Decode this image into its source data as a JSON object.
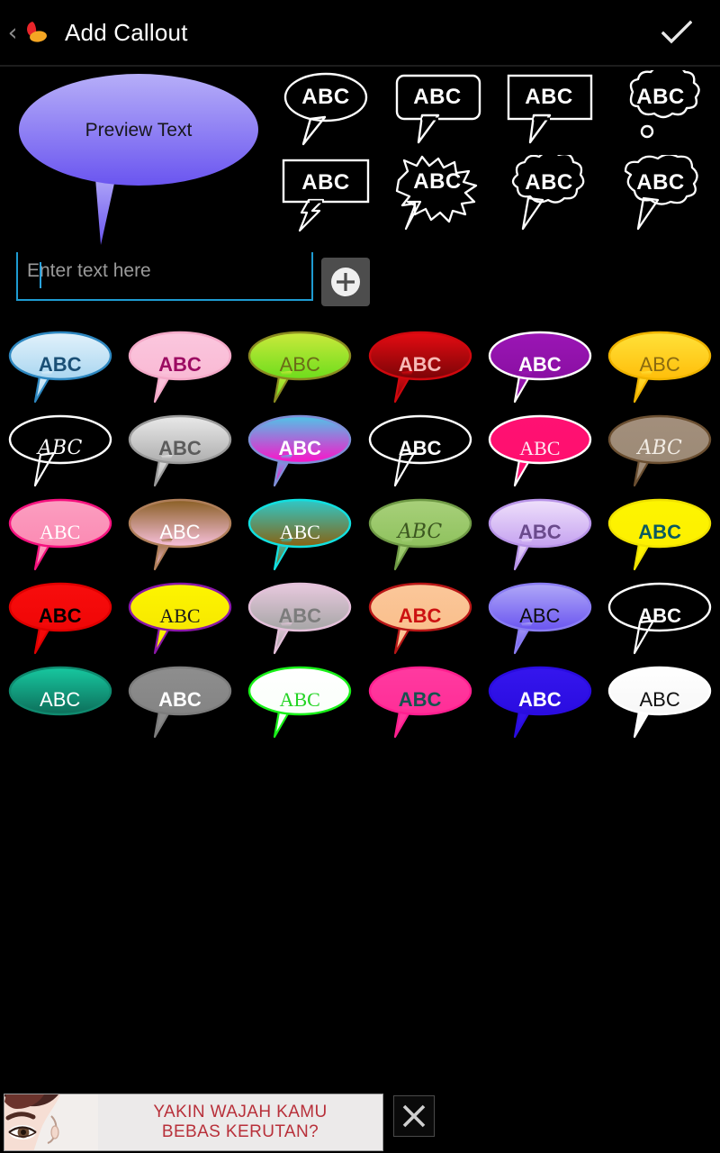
{
  "header": {
    "back_label": "‹",
    "title": "Add Callout",
    "confirm_icon": "check-icon",
    "app_icon": "app-logo-icon"
  },
  "preview": {
    "text": "Preview Text",
    "fill_top": "#b0a8f7",
    "fill_bottom": "#6a55f0",
    "text_color": "#17171b"
  },
  "shapes": {
    "sample_label": "ABC",
    "items": [
      {
        "name": "ellipse",
        "label": "ABC"
      },
      {
        "name": "rounded-rect",
        "label": "ABC"
      },
      {
        "name": "rect",
        "label": "ABC"
      },
      {
        "name": "thought-cloud",
        "label": "ABC"
      },
      {
        "name": "rect-zigzag-tail",
        "label": "ABC"
      },
      {
        "name": "starburst",
        "label": "ABC"
      },
      {
        "name": "cloud",
        "label": "ABC"
      },
      {
        "name": "rounded-cloud",
        "label": "ABC"
      }
    ]
  },
  "input": {
    "placeholder": "Enter text here",
    "value": "",
    "underline_color": "#1e9bd1",
    "add_button_icon": "plus-icon"
  },
  "styles": {
    "label": "ABC",
    "items": [
      {
        "name": "light-blue",
        "label": "ABC",
        "fill_top": "#e2f2fb",
        "fill_bottom": "#aad6f0",
        "stroke": "#2d87c0",
        "text_color": "#1a4f75",
        "font": "f-bold",
        "tail": true
      },
      {
        "name": "pink-magenta",
        "label": "ABC",
        "fill_top": "#fbc7de",
        "fill_bottom": "#f9b9d4",
        "stroke": "#f4a9c8",
        "text_color": "#9c0b62",
        "font": "f-bold",
        "tail": true
      },
      {
        "name": "yellow-green",
        "label": "ABC",
        "fill_top": "#cbe93c",
        "fill_bottom": "#6ddd1c",
        "stroke": "#8a8a20",
        "text_color": "#6b6b18",
        "font": "",
        "tail": true
      },
      {
        "name": "dark-red",
        "label": "ABC",
        "fill_top": "#e60b12",
        "fill_bottom": "#7a0407",
        "stroke": "#d0080e",
        "text_color": "#f7b9b6",
        "font": "f-bold",
        "tail": true
      },
      {
        "name": "purple-white-border",
        "label": "ABC",
        "fill_top": "#9b16b5",
        "fill_bottom": "#8a0fa3",
        "stroke": "#ffffff",
        "text_color": "#ffffff",
        "font": "f-bold",
        "tail": true
      },
      {
        "name": "yellow-brown-text",
        "label": "ABC",
        "fill_top": "#ffe23a",
        "fill_bottom": "#ffbe0a",
        "stroke": "#f0b400",
        "text_color": "#8a6a10",
        "font": "",
        "tail": true
      },
      {
        "name": "outline-white-hand",
        "label": "ABC",
        "fill_top": "transparent",
        "fill_bottom": "transparent",
        "stroke": "#ffffff",
        "text_color": "#ffffff",
        "font": "f-hand",
        "tail": true
      },
      {
        "name": "silver-grey",
        "label": "ABC",
        "fill_top": "#e9e9e9",
        "fill_bottom": "#aeaeae",
        "stroke": "#9a9a9a",
        "text_color": "#5c5c5c",
        "font": "f-bold",
        "tail": true
      },
      {
        "name": "cyan-magenta-gradient",
        "label": "ABC",
        "fill_top": "#4fc5e8",
        "fill_bottom": "#ff10c8",
        "stroke": "#7f8fd8",
        "text_color": "#ffffff",
        "font": "f-bold",
        "tail": true
      },
      {
        "name": "outline-white-bold",
        "label": "ABC",
        "fill_top": "transparent",
        "fill_bottom": "transparent",
        "stroke": "#ffffff",
        "text_color": "#ffffff",
        "font": "f-bold",
        "tail": true
      },
      {
        "name": "hot-pink-serif",
        "label": "ABC",
        "fill_top": "#ff1173",
        "fill_bottom": "#ff0f6e",
        "stroke": "#ffffff",
        "text_color": "#ffe8f2",
        "font": "f-serif",
        "tail": true
      },
      {
        "name": "brown-tan",
        "label": "ABC",
        "fill_top": "#a38f7c",
        "fill_bottom": "#9c8a76",
        "stroke": "#6b4f31",
        "text_color": "#f2ece4",
        "font": "f-hand",
        "tail": true
      },
      {
        "name": "pink-serif",
        "label": "ABC",
        "fill_top": "#fb9ec0",
        "fill_bottom": "#fb8ab3",
        "stroke": "#f5117e",
        "text_color": "#ffffff",
        "font": "f-serif",
        "tail": true
      },
      {
        "name": "brown-pink-gradient",
        "label": "ABC",
        "fill_top": "#8a5f24",
        "fill_bottom": "#f8c1dd",
        "stroke": "#b07f5a",
        "text_color": "#ffffff",
        "font": "",
        "tail": true
      },
      {
        "name": "teal-brown-gradient",
        "label": "ABC",
        "fill_top": "#2fc8c8",
        "fill_bottom": "#8a6210",
        "stroke": "#12e0e0",
        "text_color": "#ffffff",
        "font": "f-serif",
        "tail": true
      },
      {
        "name": "light-green-hand",
        "label": "ABC",
        "fill_top": "#a8d07a",
        "fill_bottom": "#8fc25e",
        "stroke": "#6f9a45",
        "text_color": "#3c5720",
        "font": "f-hand",
        "tail": true
      },
      {
        "name": "lavender",
        "label": "ABC",
        "fill_top": "#efe0fb",
        "fill_bottom": "#c5a2f0",
        "stroke": "#b894e8",
        "text_color": "#6a4a8c",
        "font": "f-bold",
        "tail": true
      },
      {
        "name": "bright-yellow-teal-text",
        "label": "ABC",
        "fill_top": "#fdf500",
        "fill_bottom": "#fdf000",
        "stroke": "#f0e200",
        "text_color": "#0a5a60",
        "font": "f-bold",
        "tail": true
      },
      {
        "name": "bright-red-black-text",
        "label": "ABC",
        "fill_top": "#f80d0d",
        "fill_bottom": "#ef0606",
        "stroke": "#e00000",
        "text_color": "#000000",
        "font": "f-bold",
        "tail": true
      },
      {
        "name": "yellow-purple-border",
        "label": "ABC",
        "fill_top": "#fdf500",
        "fill_bottom": "#f7e800",
        "stroke": "#8a17a8",
        "text_color": "#1a1a1a",
        "font": "f-serif",
        "tail": true
      },
      {
        "name": "pink-grey-gradient",
        "label": "ABC",
        "fill_top": "#e8c9de",
        "fill_bottom": "#a6a6a6",
        "stroke": "#e4c0da",
        "text_color": "#7c7c7c",
        "font": "f-bold",
        "tail": true
      },
      {
        "name": "peach-red-text",
        "label": "ABC",
        "fill_top": "#fbc79a",
        "fill_bottom": "#fabf8c",
        "stroke": "#b81616",
        "text_color": "#cc1111",
        "font": "f-bold",
        "tail": true
      },
      {
        "name": "purple-blue-gradient",
        "label": "ABC",
        "fill_top": "#b0a8f7",
        "fill_bottom": "#6a55f0",
        "stroke": "#8a7df3",
        "text_color": "#0d0d0d",
        "font": "",
        "tail": true
      },
      {
        "name": "outline-white-bold-2",
        "label": "ABC",
        "fill_top": "transparent",
        "fill_bottom": "transparent",
        "stroke": "#ffffff",
        "text_color": "#ffffff",
        "font": "f-bold",
        "tail": true
      },
      {
        "name": "teal-green-gradient",
        "label": "ABC",
        "fill_top": "#17c8a0",
        "fill_bottom": "#0d6e5a",
        "stroke": "#0f8a6f",
        "text_color": "#ffffff",
        "font": "",
        "tail": false
      },
      {
        "name": "grey-white-text",
        "label": "ABC",
        "fill_top": "#8e8e8e",
        "fill_bottom": "#848484",
        "stroke": "#7c7c7c",
        "text_color": "#ffffff",
        "font": "f-bold",
        "tail": true
      },
      {
        "name": "white-green-border",
        "label": "ABC",
        "fill_top": "#ffffff",
        "fill_bottom": "#fafffa",
        "stroke": "#18f018",
        "text_color": "#23d423",
        "font": "f-serif",
        "tail": true
      },
      {
        "name": "hot-pink-teal-text",
        "label": "ABC",
        "fill_top": "#ff3aa0",
        "fill_bottom": "#ff2e97",
        "stroke": "#ff1f8f",
        "text_color": "#14534f",
        "font": "f-bold",
        "tail": true
      },
      {
        "name": "blue-white-text",
        "label": "ABC",
        "fill_top": "#3516ee",
        "fill_bottom": "#2a0ce0",
        "stroke": "#2a0ce0",
        "text_color": "#ffffff",
        "font": "f-bold",
        "tail": true
      },
      {
        "name": "white-black-text",
        "label": "ABC",
        "fill_top": "#ffffff",
        "fill_bottom": "#f7f7f7",
        "stroke": "#ffffff",
        "text_color": "#111111",
        "font": "",
        "tail": true
      }
    ]
  },
  "ad": {
    "line1": "YAKIN WAJAH KAMU",
    "line2": "BEBAS KERUTAN?",
    "text_color": "#b8303a",
    "close_icon": "close-icon"
  }
}
